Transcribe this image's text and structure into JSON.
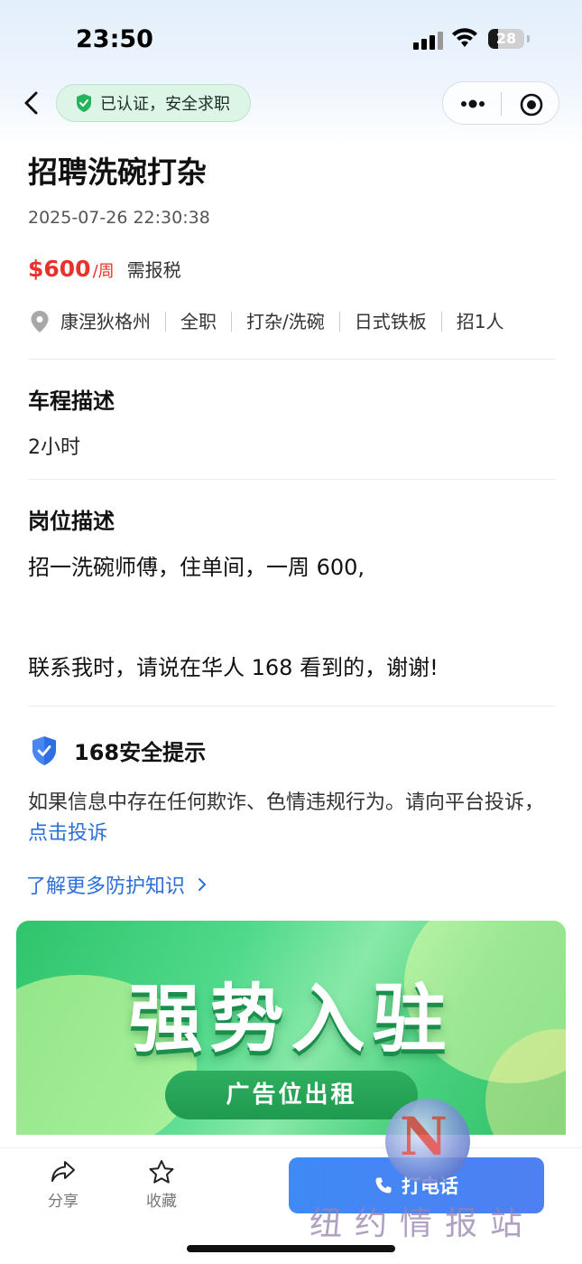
{
  "status_bar": {
    "time": "23:50",
    "battery": "28",
    "battery_level": 0.28
  },
  "nav": {
    "verify_label": "已认证，安全求职"
  },
  "job": {
    "title": "招聘洗碗打杂",
    "datetime": "2025-07-26 22:30:38",
    "salary": {
      "amount": "$600",
      "unit": "/周",
      "note": "需报税"
    },
    "tags": [
      "康涅狄格州",
      "全职",
      "打杂/洗碗",
      "日式铁板",
      "招1人"
    ]
  },
  "commute": {
    "heading": "车程描述",
    "text": "2小时"
  },
  "description": {
    "heading": "岗位描述",
    "line1": "招一洗碗师傅，住单间，一周 600,",
    "line2": "联系我时，请说在华人 168 看到的，谢谢!"
  },
  "safety": {
    "heading": "168安全提示",
    "body": "如果信息中存在任何欺诈、色情违规行为。请向平台投诉，",
    "report_link": "点击投诉",
    "learn_more": "了解更多防护知识"
  },
  "banner": {
    "headline": "强势入驻",
    "sub": "广告位出租"
  },
  "bottom": {
    "share": "分享",
    "favorite": "收藏",
    "call": "打电话"
  },
  "watermark": {
    "text": "纽约情报站"
  },
  "colors": {
    "accent": "#3f8af5",
    "price": "#e8322b",
    "link": "#2d6fd8",
    "verify_bg": "#ddf5e6"
  },
  "icons": [
    "back-icon",
    "shield-check-icon",
    "more-dots-icon",
    "target-icon",
    "location-pin-icon",
    "shield-icon",
    "chevron-right-icon",
    "share-icon",
    "star-icon",
    "phone-icon"
  ]
}
